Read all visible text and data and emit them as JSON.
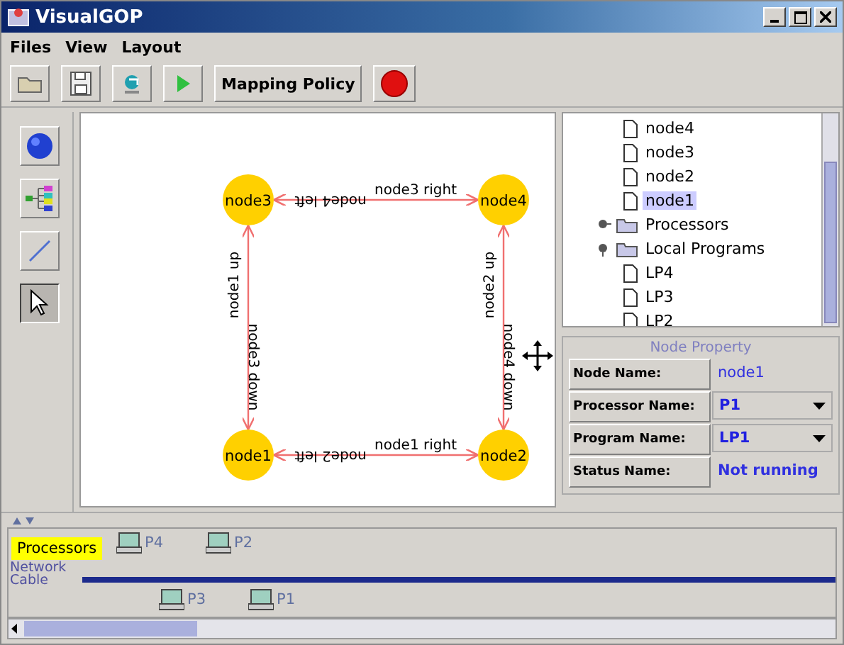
{
  "window": {
    "title": "VisualGOP"
  },
  "menu": [
    {
      "label": "Files"
    },
    {
      "label": "View"
    },
    {
      "label": "Layout"
    }
  ],
  "toolbar": [
    {
      "kind": "open"
    },
    {
      "kind": "save"
    },
    {
      "kind": "refresh"
    },
    {
      "kind": "run"
    },
    {
      "kind": "text",
      "label": "Mapping Policy"
    },
    {
      "kind": "stop"
    }
  ],
  "tools": [
    {
      "kind": "globe",
      "selected": false
    },
    {
      "kind": "hierarchy",
      "selected": false
    },
    {
      "kind": "line",
      "selected": false
    },
    {
      "kind": "pointer",
      "selected": true
    }
  ],
  "graph": {
    "nodes": [
      {
        "label": "node3"
      },
      {
        "label": "node4"
      },
      {
        "label": "node1"
      },
      {
        "label": "node2"
      }
    ],
    "edges": [
      {
        "forward_label": "node3 right",
        "back_label": "node4 left"
      },
      {
        "forward_label": "node1 up",
        "back_label": "node3 down"
      },
      {
        "forward_label": "node2 up",
        "back_label": "node4 down"
      },
      {
        "forward_label": "node1 right",
        "back_label": "node2 left"
      }
    ]
  },
  "tree": {
    "items": [
      {
        "kind": "continuation",
        "children": [
          {
            "label": "node4",
            "kind": "leaf",
            "selected": false
          },
          {
            "label": "node3",
            "kind": "leaf",
            "selected": false
          },
          {
            "label": "node2",
            "kind": "leaf",
            "selected": false
          },
          {
            "label": "node1",
            "kind": "leaf",
            "selected": true
          }
        ]
      },
      {
        "label": "Processors",
        "kind": "folder",
        "expanded": false
      },
      {
        "label": "Local Programs",
        "kind": "folder",
        "expanded": true,
        "children": [
          {
            "label": "LP4",
            "kind": "leaf",
            "selected": false
          },
          {
            "label": "LP3",
            "kind": "leaf",
            "selected": false
          },
          {
            "label": "LP2",
            "kind": "leaf",
            "selected": false
          }
        ]
      }
    ]
  },
  "node_property": {
    "title": "Node Property",
    "rows": [
      {
        "label": "Node Name:",
        "value": "node1",
        "kind": "text"
      },
      {
        "label": "Processor Name:",
        "value": "P1",
        "kind": "dropdown"
      },
      {
        "label": "Program Name:",
        "value": "LP1",
        "kind": "dropdown"
      },
      {
        "label": "Status Name:",
        "value": "Not running",
        "kind": "status"
      }
    ]
  },
  "network": {
    "title": "Processors",
    "cable_label": "Network Cable",
    "processors": [
      {
        "label": "P4"
      },
      {
        "label": "P2"
      },
      {
        "label": "P3"
      },
      {
        "label": "P1"
      }
    ]
  }
}
